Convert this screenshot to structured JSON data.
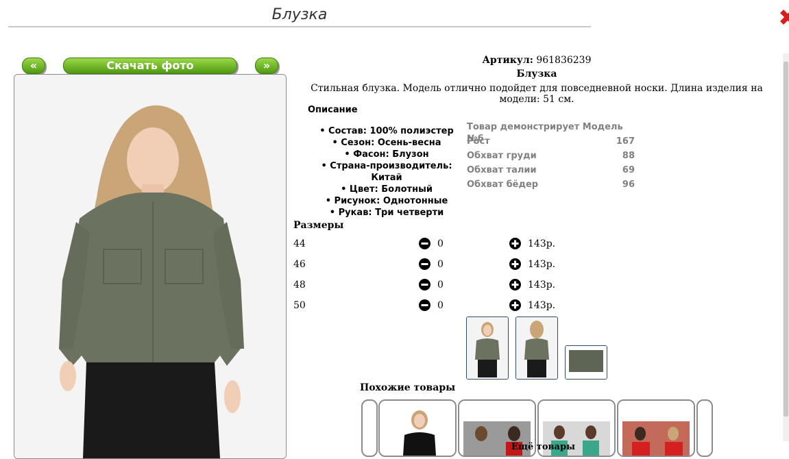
{
  "page": {
    "title": "Блузка"
  },
  "nav": {
    "prev_label": "«",
    "download_label": "Скачать фото",
    "next_label": "»"
  },
  "product": {
    "article_label": "Артикул:",
    "article_value": "961836239",
    "name": "Блузка",
    "description": "Стильная блузка. Модель отлично подойдет для повседневной носки. Длина изделия на модели: 51 см."
  },
  "details": {
    "heading": "Описание",
    "items": [
      "• Состав: 100% полиэстер",
      "• Сезон: Осень-весна",
      "• Фасон: Блузон",
      "• Страна-производитель: Китай",
      "• Цвет: Болотный",
      "• Рисунок: Однотонные",
      "• Рукав: Три четверти"
    ]
  },
  "model": {
    "heading": "Товар демонстрирует Модель №6",
    "rows": [
      {
        "label": "Рост",
        "value": "167"
      },
      {
        "label": "Обхват груди",
        "value": "88"
      },
      {
        "label": "Обхват талии",
        "value": "69"
      },
      {
        "label": "Обхват бёдер",
        "value": "96"
      }
    ]
  },
  "sizes": {
    "heading": "Размеры",
    "rows": [
      {
        "size": "44",
        "qty": "0",
        "price": "143р."
      },
      {
        "size": "46",
        "qty": "0",
        "price": "143р."
      },
      {
        "size": "48",
        "qty": "0",
        "price": "143р."
      },
      {
        "size": "50",
        "qty": "0",
        "price": "143р."
      }
    ]
  },
  "similar": {
    "heading": "Похожие товары",
    "more_label": "Ещё товары"
  },
  "colors": {
    "accent_green": "#5fae1c",
    "blouse_olive": "#6b7360",
    "thumb_border": "#2f4a66"
  },
  "icons": {
    "minus": "minus-circle-icon",
    "plus": "plus-circle-icon",
    "close": "close-icon"
  }
}
